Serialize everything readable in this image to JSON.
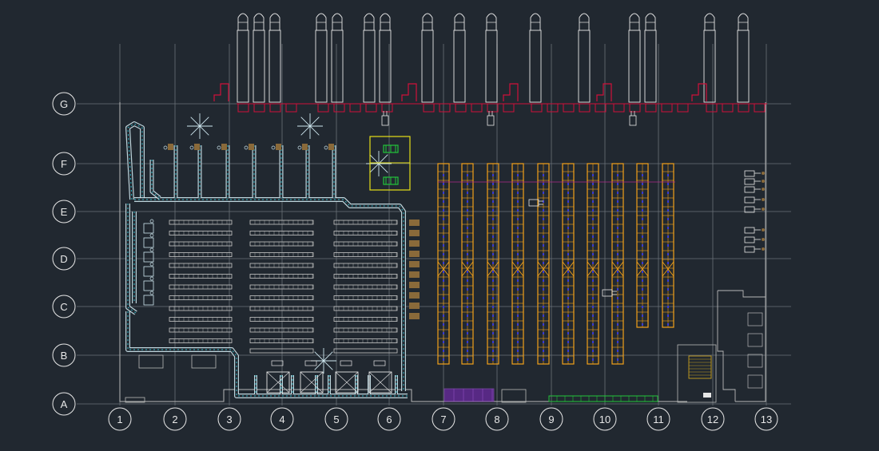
{
  "drawing": {
    "background": "#212830",
    "grid_rows": [
      "G",
      "F",
      "E",
      "D",
      "C",
      "B",
      "A"
    ],
    "grid_cols": [
      "1",
      "2",
      "3",
      "4",
      "5",
      "6",
      "7",
      "8",
      "9",
      "10",
      "11",
      "12",
      "13"
    ],
    "colors": {
      "grid_line": "#6a7178",
      "bubble": "#e6e6e6",
      "trucks": "#e6e6e6",
      "dock_doors": "#d0103a",
      "conveyor": "#cfe8f0",
      "conveyor_accent": "#2fb8c8",
      "rack_frame": "#f2a11a",
      "rack_accent": "#3a3ad0",
      "pick_tables": "#c8c8c8",
      "packing_stations": "#e6e6e6",
      "yellow_zone": "#e6e018",
      "green_equipment": "#22c53a",
      "brown_pallets": "#8a6a3a",
      "purple_zone": "#6a2aa0",
      "office": "#b8b8b8"
    },
    "icons": [
      "truck-icon",
      "dock-leveler-icon",
      "forklift-icon",
      "light-fixture-icon",
      "pallet-jack-icon"
    ]
  }
}
